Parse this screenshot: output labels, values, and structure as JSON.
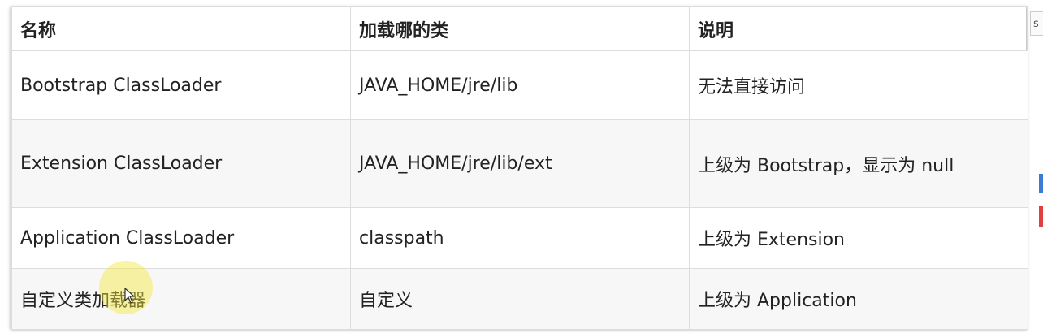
{
  "table": {
    "headers": [
      "名称",
      "加载哪的类",
      "说明"
    ],
    "rows": [
      [
        "Bootstrap ClassLoader",
        "JAVA_HOME/jre/lib",
        "无法直接访问"
      ],
      [
        "Extension ClassLoader",
        "JAVA_HOME/jre/lib/ext",
        "上级为 Bootstrap，显示为 null"
      ],
      [
        "Application ClassLoader",
        "classpath",
        "上级为 Extension"
      ],
      [
        "自定义类加载器",
        "自定义",
        "上级为 Application"
      ]
    ]
  },
  "edge": {
    "text": "s"
  },
  "colors": {
    "highlight": "#f5e63c",
    "stripe": "#f7f7f7",
    "border": "#dddddd"
  },
  "icons": {
    "cursor": "mouse-pointer-icon"
  }
}
